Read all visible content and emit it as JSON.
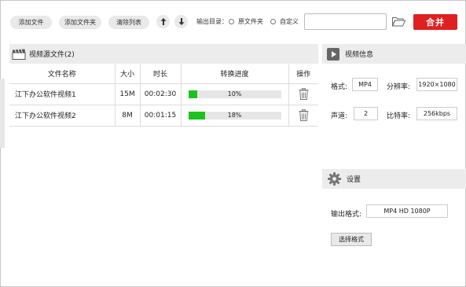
{
  "toolbar": {
    "add_file": "添加文件",
    "add_folder": "添加文件夹",
    "clear_list": "清除列表",
    "output_dir_label": "输出目录：",
    "option_original": "原文件夹",
    "option_custom": "自定义",
    "path_value": "",
    "merge": "合并",
    "icons": {
      "up": "arrow-up-icon",
      "down": "arrow-down-icon",
      "folder": "folder-icon"
    }
  },
  "source": {
    "title": "视频源文件(2)",
    "columns": [
      "文件名称",
      "大小",
      "时长",
      "转换进度",
      "操作"
    ],
    "rows": [
      {
        "name": "江下办公软件视频1",
        "size": "15M",
        "duration": "00:02:30",
        "progress_text": "10%",
        "progress": 0.1
      },
      {
        "name": "江下办公软件视频2",
        "size": "8M",
        "duration": "00:01:15",
        "progress_text": "18%",
        "progress": 0.18
      }
    ]
  },
  "info": {
    "title": "视频信息",
    "format_label": "格式:",
    "format_value": "MP4",
    "resolution_label": "分辨率:",
    "resolution_value": "1920×1080",
    "channels_label": "声道:",
    "channels_value": "2",
    "bitrate_label": "比特率:",
    "bitrate_value": "256kbps"
  },
  "settings": {
    "title": "设置",
    "output_format_label": "输出格式:",
    "output_format_value": "MP4  HD  1080P",
    "choose_format": "选择格式"
  },
  "colors": {
    "accent": "#e02020",
    "progress": "#1ec21e",
    "header_bg": "#ececec"
  }
}
